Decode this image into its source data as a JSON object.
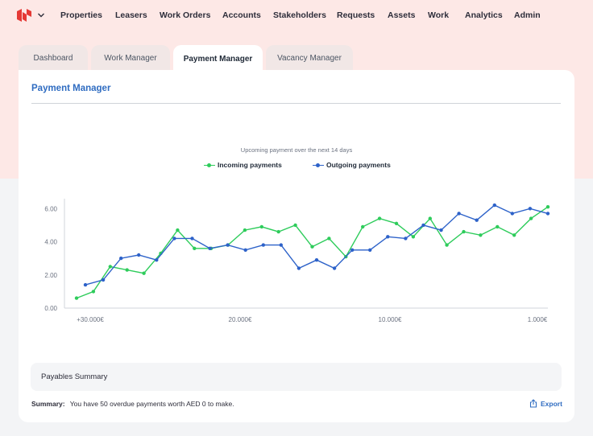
{
  "nav": {
    "items": [
      "Properties",
      "Leasers",
      "Work Orders",
      "Accounts",
      "Stakeholders",
      "Requests",
      "Assets",
      "Work",
      "Analytics",
      "Admin"
    ]
  },
  "tabs": [
    "Dashboard",
    "Work Manager",
    "Payment Manager",
    "Vacancy Manager"
  ],
  "active_tab": "Payment Manager",
  "card": {
    "title": "Payment Manager"
  },
  "payables": {
    "label": "Payables Summary"
  },
  "summary": {
    "label": "Summary:",
    "text": "You have 50 overdue payments worth AED 0 to make."
  },
  "export": {
    "label": "Export"
  },
  "colors": {
    "accent": "#2f6cc1",
    "incoming": "#2ecc5b",
    "outgoing": "#2d62c9",
    "brand": "#e53935"
  },
  "chart_data": {
    "type": "line",
    "title": "Upcoming payment over the next 14 days",
    "x_tick_labels": [
      "+30.000€",
      "20.000€",
      "10.000€",
      "1.000€"
    ],
    "y_ticks": [
      "0.00",
      "2.00",
      "4.00",
      "6.00"
    ],
    "ylim": [
      0,
      6.4
    ],
    "legend_position": "top-center",
    "series": [
      {
        "name": "Incoming payments",
        "color": "#2ecc5b",
        "values": [
          0.6,
          1.0,
          2.5,
          2.3,
          2.1,
          3.3,
          4.7,
          3.6,
          3.6,
          3.8,
          4.7,
          4.9,
          4.6,
          5.0,
          3.7,
          4.2,
          3.1,
          4.9,
          5.4,
          5.1,
          4.3,
          5.4,
          3.8,
          4.6,
          4.4,
          4.9,
          4.4,
          5.4,
          6.1
        ]
      },
      {
        "name": "Outgoing payments",
        "color": "#2d62c9",
        "values": [
          1.4,
          1.7,
          3.0,
          3.2,
          2.9,
          4.2,
          4.2,
          3.6,
          3.8,
          3.5,
          3.8,
          3.8,
          2.4,
          2.9,
          2.4,
          3.5,
          3.5,
          4.3,
          4.2,
          5.0,
          4.7,
          5.7,
          5.3,
          6.2,
          5.7,
          6.0,
          5.7
        ]
      }
    ]
  }
}
